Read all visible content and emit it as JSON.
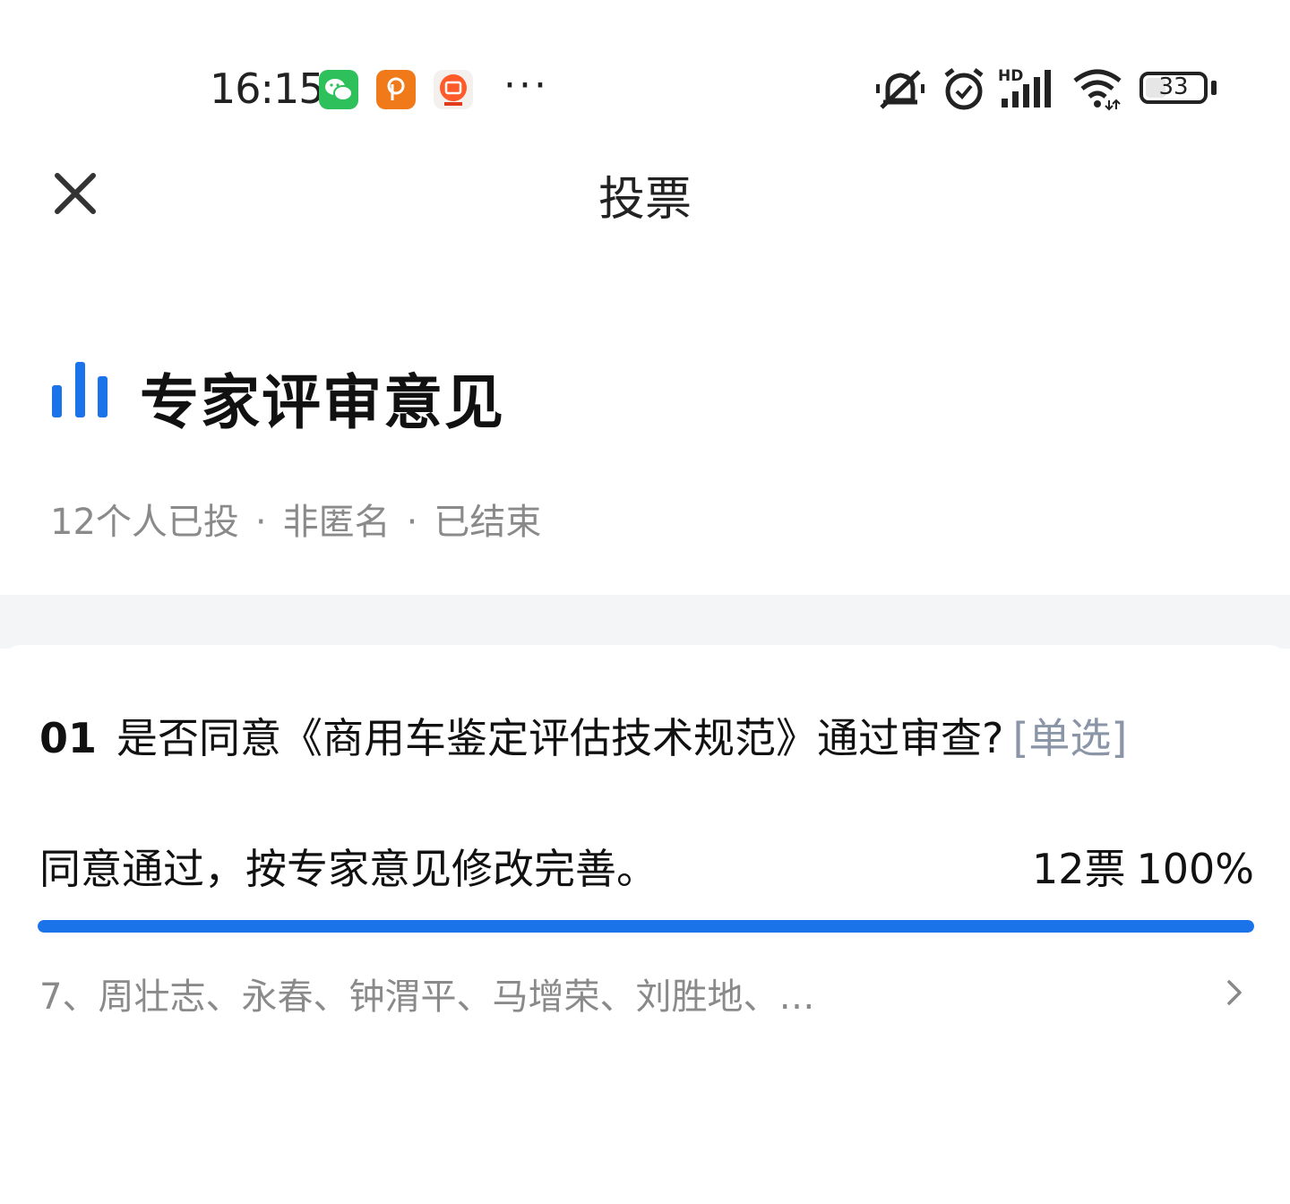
{
  "status_bar": {
    "time": "16:15",
    "apps": [
      "wechat-icon",
      "p-app-icon",
      "taobao-icon"
    ],
    "more": "···",
    "battery": "33",
    "battery_level": 0.33,
    "icons": [
      "mute-icon",
      "alarm-icon",
      "hd-signal-icon",
      "wifi-icon",
      "battery-icon"
    ]
  },
  "nav": {
    "title": "投票",
    "close_icon": "close-icon"
  },
  "poll": {
    "title": "专家评审意见",
    "icon": "bar-chart-icon",
    "meta": [
      "12个人已投",
      "非匿名",
      "已结束"
    ],
    "meta_separator": "·"
  },
  "question": {
    "number": "01",
    "text": "是否同意《商用车鉴定评估技术规范》通过审查?",
    "type": "[单选]",
    "options": [
      {
        "label": "同意通过，按专家意见修改完善。",
        "votes": "12票",
        "percent": "100%",
        "fraction": 1.0,
        "voters": "7、周壮志、永春、钟渭平、马增荣、刘胜地、…"
      }
    ]
  },
  "colors": {
    "accent": "#1a73e8",
    "muted_text": "#8a8a8a",
    "type_tag": "#8a95a8",
    "band": "#f4f5f7"
  }
}
